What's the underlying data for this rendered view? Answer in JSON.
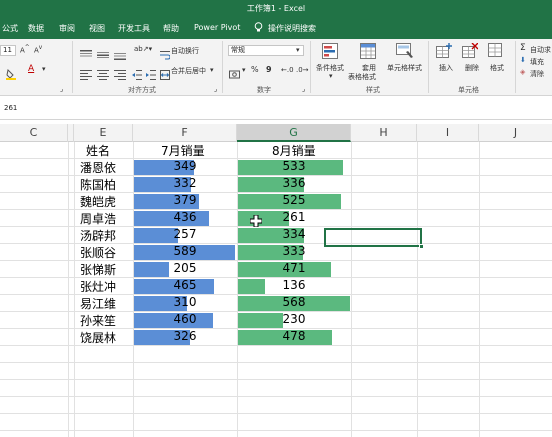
{
  "window": {
    "title": "工作簿1 - Excel"
  },
  "ribbon_tabs": [
    "公式",
    "数据",
    "审阅",
    "视图",
    "开发工具",
    "帮助",
    "Power Pivot",
    "操作说明搜索"
  ],
  "ribbon": {
    "font_size": "11",
    "wrap_text": "自动换行",
    "merge_center": "合并后居中",
    "alignment_label": "对齐方式",
    "number_format": "常规",
    "percent": "%",
    "comma": "9",
    "number_label": "数字",
    "cond_format": "条件格式",
    "table_format_1": "套用",
    "table_format_2": "表格格式",
    "cell_styles": "单元格样式",
    "styles_label": "样式",
    "insert": "插入",
    "delete": "删除",
    "format": "格式",
    "cells_label": "单元格",
    "autosum": "自动求",
    "fill": "填充",
    "clear": "清除",
    "accent": "#217346"
  },
  "formula_bar": {
    "value": "261"
  },
  "columns": [
    "C",
    "D",
    "E",
    "F",
    "G",
    "H",
    "I",
    "J"
  ],
  "active_column": "G",
  "table": {
    "headers": [
      "姓名",
      "7月销量",
      "8月销量"
    ],
    "rows": [
      {
        "name": "潘恩依",
        "jul": 349,
        "aug": 533
      },
      {
        "name": "陈国柏",
        "jul": 332,
        "aug": 336
      },
      {
        "name": "魏皑虎",
        "jul": 379,
        "aug": 525
      },
      {
        "name": "周卓浩",
        "jul": 436,
        "aug": 261
      },
      {
        "name": "汤辟邦",
        "jul": 257,
        "aug": 334
      },
      {
        "name": "张顺谷",
        "jul": 589,
        "aug": 333
      },
      {
        "name": "张悌斯",
        "jul": 205,
        "aug": 471
      },
      {
        "name": "张灶冲",
        "jul": 465,
        "aug": 136
      },
      {
        "name": "易江维",
        "jul": 310,
        "aug": 568
      },
      {
        "name": "孙来笙",
        "jul": 460,
        "aug": 230
      },
      {
        "name": "饶展林",
        "jul": 326,
        "aug": 478
      }
    ],
    "bar_colors": {
      "jul": "#5b8ed6",
      "aug": "#5bb97f"
    }
  }
}
